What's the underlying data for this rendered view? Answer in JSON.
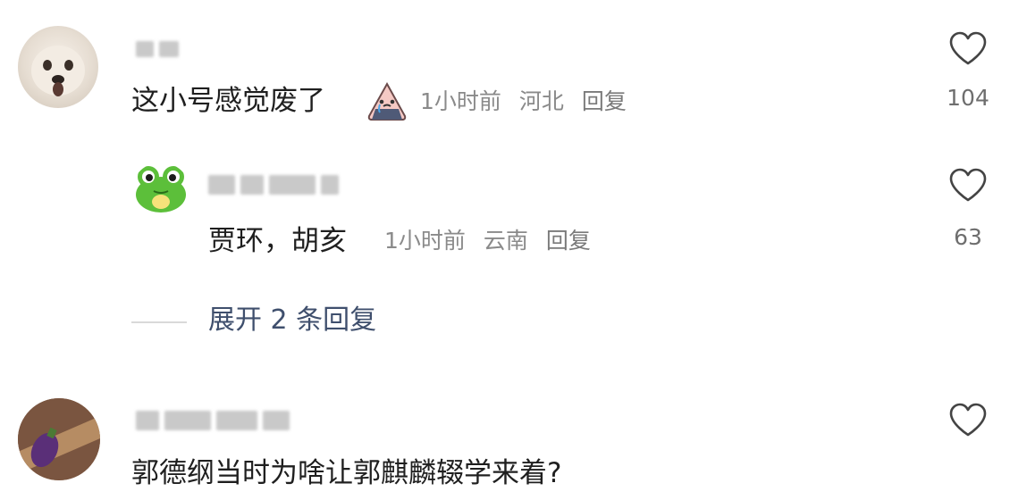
{
  "comments": [
    {
      "text": "这小号感觉废了",
      "time": "1小时前",
      "location": "河北",
      "reply_label": "回复",
      "likes": "104"
    },
    {
      "text": "贾环，胡亥",
      "time": "1小时前",
      "location": "云南",
      "reply_label": "回复",
      "likes": "63"
    },
    {
      "text": "郭德纲当时为啥让郭麒麟辍学来着?"
    }
  ],
  "expand_replies": "展开 2 条回复",
  "icons": {
    "like": "heart-outline-icon",
    "emoji": "crying-onigiri-emoji-icon"
  },
  "colors": {
    "text": "#1f1f1f",
    "meta": "#8a8a8a",
    "expand": "#3f4f6d"
  }
}
